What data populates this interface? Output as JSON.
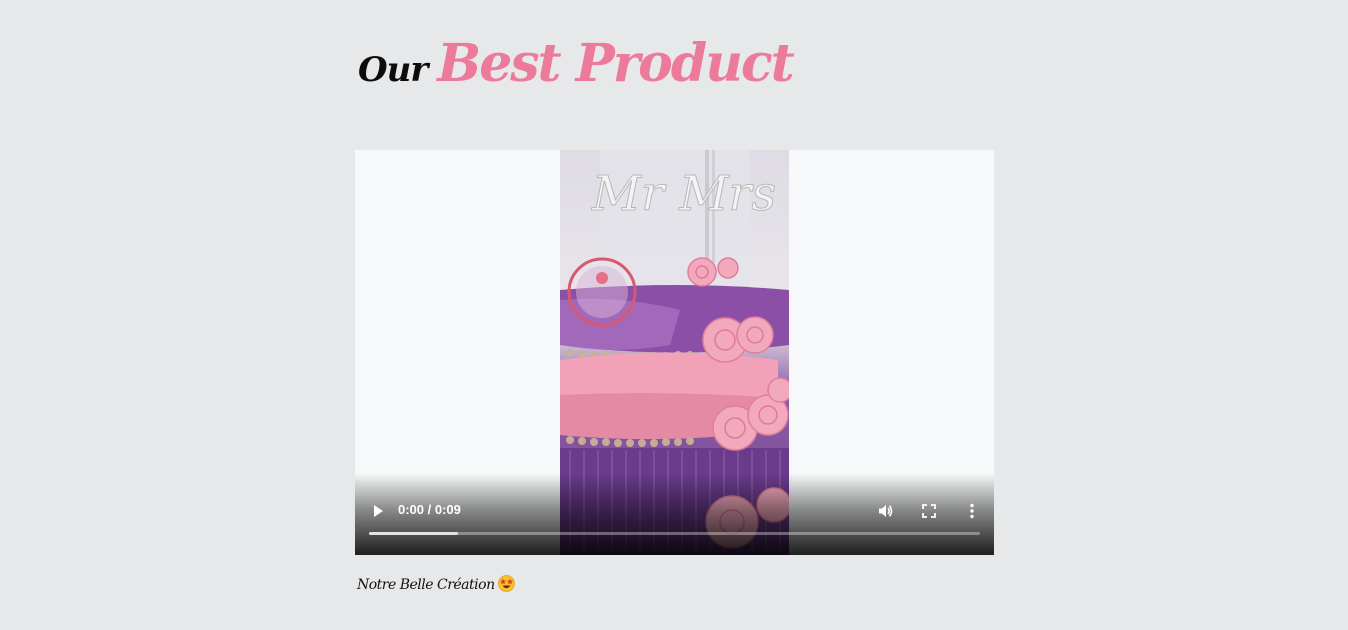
{
  "heading": {
    "prefix": "Our",
    "highlight": "Best Product"
  },
  "video": {
    "time_display": "0:00 / 0:09",
    "buffered_fraction": 0.146,
    "play_icon": "play-icon",
    "volume_icon": "volume-icon",
    "fullscreen_icon": "fullscreen-icon",
    "more_icon": "more-vert-icon",
    "cake_topper_text": "Mr Mrs"
  },
  "caption": {
    "text": "Notre Belle Création",
    "emoji_icon": "star-struck-emoji-icon"
  },
  "colors": {
    "accent_pink": "#ec7a9b",
    "background": "#e7e8e9"
  }
}
